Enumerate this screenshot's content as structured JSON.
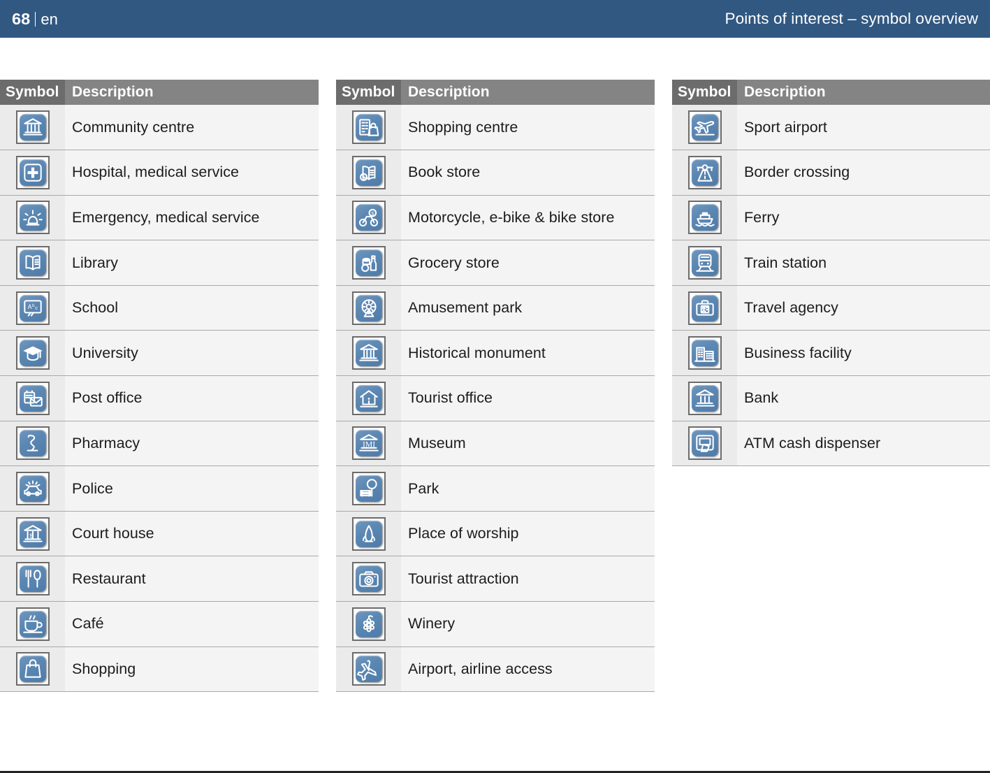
{
  "header": {
    "page_number": "68",
    "separator": "|",
    "language": "en",
    "title": "Points of interest – symbol overview"
  },
  "table_headers": {
    "symbol": "Symbol",
    "description": "Description"
  },
  "colors": {
    "header_band": "#315881",
    "th_symbol_bg": "#6d6c6c",
    "th_description_bg": "#858484",
    "row_symbol_bg": "#ebebeb",
    "row_description_bg": "#f4f4f4",
    "row_border": "#a9a9a9",
    "icon_blue": "#5b87b3",
    "icon_frame": "#6b6b6b",
    "text": "#1c1c1c"
  },
  "columns": [
    {
      "rows": [
        {
          "icon": "community-centre-icon",
          "label": "Community centre"
        },
        {
          "icon": "hospital-icon",
          "label": "Hospital, medical service"
        },
        {
          "icon": "emergency-icon",
          "label": "Emergency, medical service"
        },
        {
          "icon": "library-icon",
          "label": "Library"
        },
        {
          "icon": "school-icon",
          "label": "School"
        },
        {
          "icon": "university-icon",
          "label": "University"
        },
        {
          "icon": "post-office-icon",
          "label": "Post office"
        },
        {
          "icon": "pharmacy-icon",
          "label": "Pharmacy"
        },
        {
          "icon": "police-icon",
          "label": "Police"
        },
        {
          "icon": "court-house-icon",
          "label": "Court house"
        },
        {
          "icon": "restaurant-icon",
          "label": "Restaurant"
        },
        {
          "icon": "cafe-icon",
          "label": "Café"
        },
        {
          "icon": "shopping-icon",
          "label": "Shopping"
        }
      ]
    },
    {
      "rows": [
        {
          "icon": "shopping-centre-icon",
          "label": "Shopping centre"
        },
        {
          "icon": "book-store-icon",
          "label": "Book store"
        },
        {
          "icon": "motorcycle-bike-store-icon",
          "label": "Motorcycle, e-bike & bike store"
        },
        {
          "icon": "grocery-store-icon",
          "label": "Grocery store"
        },
        {
          "icon": "amusement-park-icon",
          "label": "Amusement park"
        },
        {
          "icon": "historical-monument-icon",
          "label": "Historical monument"
        },
        {
          "icon": "tourist-office-icon",
          "label": "Tourist office"
        },
        {
          "icon": "museum-icon",
          "label": "Museum"
        },
        {
          "icon": "park-icon",
          "label": "Park"
        },
        {
          "icon": "place-of-worship-icon",
          "label": "Place of worship"
        },
        {
          "icon": "tourist-attraction-icon",
          "label": "Tourist attraction"
        },
        {
          "icon": "winery-icon",
          "label": "Winery"
        },
        {
          "icon": "airport-icon",
          "label": "Airport, airline access"
        }
      ]
    },
    {
      "rows": [
        {
          "icon": "sport-airport-icon",
          "label": "Sport airport"
        },
        {
          "icon": "border-crossing-icon",
          "label": "Border crossing"
        },
        {
          "icon": "ferry-icon",
          "label": "Ferry"
        },
        {
          "icon": "train-station-icon",
          "label": "Train station"
        },
        {
          "icon": "travel-agency-icon",
          "label": "Travel agency"
        },
        {
          "icon": "business-facility-icon",
          "label": "Business facility"
        },
        {
          "icon": "bank-icon",
          "label": "Bank"
        },
        {
          "icon": "atm-icon",
          "label": "ATM cash dispenser"
        }
      ]
    }
  ]
}
